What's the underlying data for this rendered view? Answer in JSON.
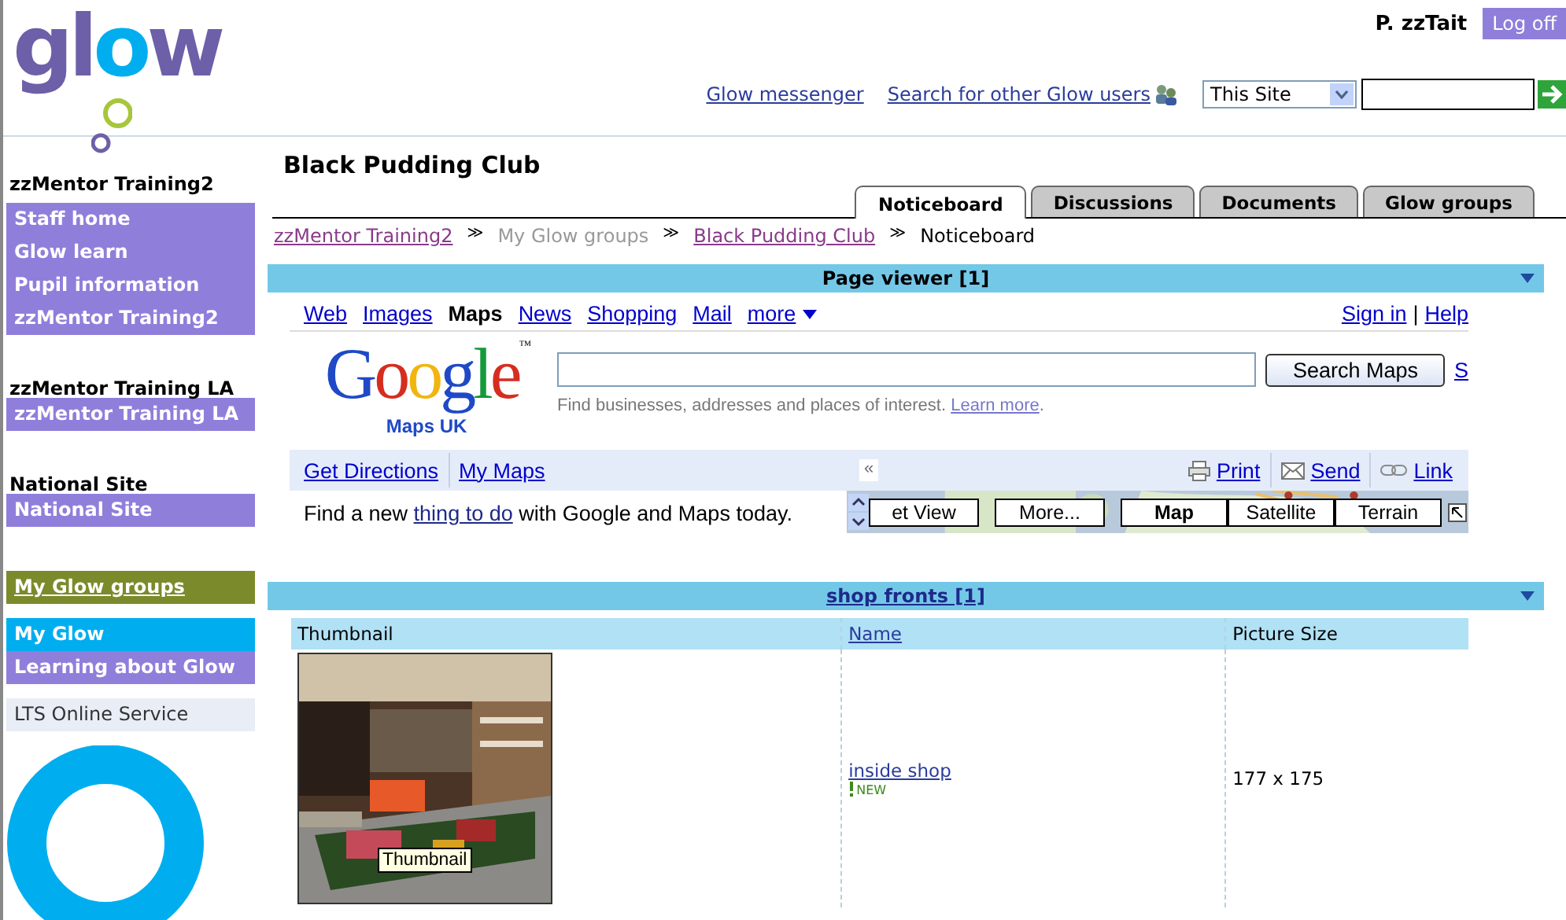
{
  "header": {
    "logo": "glow",
    "user": "P. zzTait",
    "logoff": "Log off",
    "links": [
      "Glow messenger",
      "Search for other Glow users"
    ],
    "scope_select": {
      "value": "This Site"
    }
  },
  "sidebar": {
    "sections": [
      {
        "heading": "zzMentor Training2",
        "items": [
          {
            "label": "Staff home",
            "color": "#8f7fdb"
          },
          {
            "label": "Glow learn",
            "color": "#8f7fdb"
          },
          {
            "label": "Pupil information",
            "color": "#8f7fdb"
          },
          {
            "label": "zzMentor Training2",
            "color": "#8f7fdb"
          }
        ]
      },
      {
        "heading": "zzMentor Training LA",
        "items": [
          {
            "label": "zzMentor Training LA",
            "color": "#8f7fdb"
          }
        ]
      },
      {
        "heading": "National Site",
        "items": [
          {
            "label": "National Site",
            "color": "#8f7fdb"
          }
        ]
      },
      {
        "items": [
          {
            "label": "My Glow groups",
            "color": "#7b8b2b",
            "underlined": true
          }
        ]
      },
      {
        "items": [
          {
            "label": "My Glow",
            "color": "#00aeef"
          },
          {
            "label": "Learning about Glow",
            "color": "#8f7fdb"
          }
        ]
      },
      {
        "items": [
          {
            "label": "LTS Online Service",
            "color": "#e8edf6"
          }
        ]
      }
    ]
  },
  "main": {
    "title": "Black Pudding Club",
    "tabs": [
      {
        "label": "Noticeboard",
        "selected": true
      },
      {
        "label": "Discussions",
        "selected": false
      },
      {
        "label": "Documents",
        "selected": false
      },
      {
        "label": "Glow groups",
        "selected": false
      }
    ],
    "breadcrumb": [
      {
        "label": "zzMentor Training2",
        "kind": "link"
      },
      {
        "label": "≫",
        "kind": "separator"
      },
      {
        "label": "My Glow groups",
        "kind": "muted"
      },
      {
        "label": "≫",
        "kind": "separator"
      },
      {
        "label": "Black Pudding Club",
        "kind": "link"
      },
      {
        "label": "≫",
        "kind": "separator"
      },
      {
        "label": "Noticeboard",
        "kind": "current"
      }
    ],
    "page_viewer": {
      "title": "Page viewer [1]",
      "nav": [
        {
          "label": "Web",
          "selected": false
        },
        {
          "label": "Images",
          "selected": false
        },
        {
          "label": "Maps",
          "selected": true
        },
        {
          "label": "News",
          "selected": false
        },
        {
          "label": "Shopping",
          "selected": false
        },
        {
          "label": "Mail",
          "selected": false
        },
        {
          "label": "more",
          "selected": false
        }
      ],
      "account_links": [
        "Sign in",
        "|",
        "Help"
      ],
      "logo": {
        "text": "Google",
        "tm": "™",
        "sub": "Maps UK"
      },
      "search_button": "Search Maps",
      "cut_link": "S",
      "hint": {
        "text": "Find businesses, addresses and places of interest. ",
        "link": "Learn more",
        "after": "."
      },
      "toolbar_links": [
        "Get Directions",
        "My Maps"
      ],
      "collapse": "«",
      "actions": [
        {
          "label": "Print",
          "kind": "print"
        },
        {
          "label": "Send",
          "kind": "send"
        },
        {
          "label": "Link",
          "kind": "link"
        }
      ],
      "promo": {
        "before": "Find a new ",
        "link": "thing to do",
        "after": " with Google and Maps today."
      },
      "map_buttons": [
        {
          "label": "et View",
          "selected": false
        },
        {
          "label": "More...",
          "selected": false
        },
        {
          "label": "Map",
          "selected": true
        },
        {
          "label": "Satellite",
          "selected": false
        },
        {
          "label": "Terrain",
          "selected": false
        }
      ]
    },
    "shop_fronts": {
      "title": "shop fronts [1]",
      "columns": [
        {
          "label": "Thumbnail",
          "link": false
        },
        {
          "label": "Name",
          "link": true
        },
        {
          "label": "Picture Size",
          "link": false
        }
      ],
      "rows": [
        {
          "thumbnail": {
            "kind": "picture",
            "tooltip": "Thumbnail"
          },
          "name": "inside shop",
          "badge": "NEW",
          "size": "177 x 175"
        }
      ]
    }
  }
}
